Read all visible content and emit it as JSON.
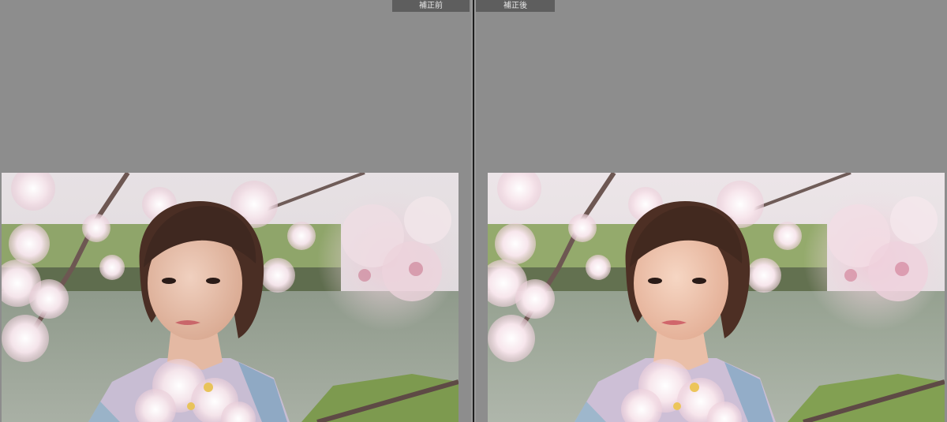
{
  "compare_view": {
    "before": {
      "label": "補正前"
    },
    "after": {
      "label": "補正後"
    }
  },
  "colors": {
    "canvas_gray": "#8c8c8c",
    "label_tab_bg": "#5e5e5e",
    "label_text": "#e6e6e6",
    "divider": "#1e1e1e"
  },
  "photo": {
    "subject": "portrait-woman-cherry-blossoms"
  }
}
